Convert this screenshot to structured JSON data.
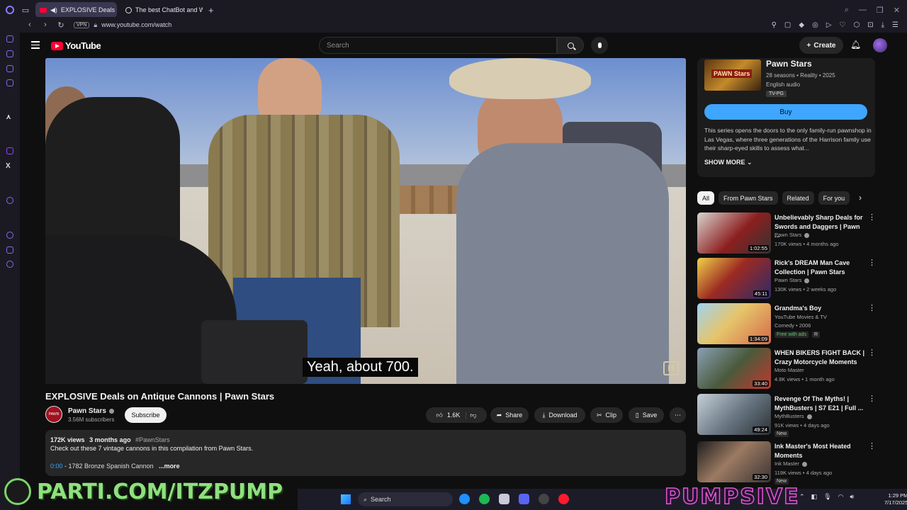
{
  "browser": {
    "tabs": [
      {
        "title": "EXPLOSIVE Deals on A",
        "active": true
      },
      {
        "title": "The best ChatBot and W",
        "active": false
      }
    ],
    "vpn_label": "VPN",
    "url": "www.youtube.com/watch"
  },
  "youtube": {
    "logo_text": "YouTube",
    "search_placeholder": "Search",
    "create_label": "Create"
  },
  "player": {
    "caption": "Yeah, about 700.",
    "watermark": "H"
  },
  "video": {
    "title": "EXPLOSIVE Deals on Antique Cannons | Pawn Stars",
    "channel_name": "Pawn Stars",
    "channel_avatar_text": "PAWN",
    "subscribers": "3.56M subscribers",
    "subscribe_label": "Subscribe",
    "likes": "1.6K",
    "share_label": "Share",
    "download_label": "Download",
    "clip_label": "Clip",
    "save_label": "Save",
    "views": "172K views",
    "age": "3 months ago",
    "hashtag": "#PawnStars",
    "description": "Check out these 7 vintage cannons in this compilation from Pawn Stars.",
    "chapter_time": "0:00",
    "chapter_text": " - 1782 Bronze Spanish Cannon",
    "more_label": "...more"
  },
  "show_panel": {
    "title": "Pawn Stars",
    "thumb_text": "PAWN Stars",
    "meta1": "28 seasons • Reality • 2025",
    "meta2": "English audio",
    "rating": "TV-PG",
    "buy_label": "Buy",
    "description": "This series opens the doors to the only family-run pawnshop in Las Vegas, where three generations of the Harrison family use their sharp-eyed skills to assess what...",
    "show_more": "SHOW MORE"
  },
  "chips": [
    "All",
    "From Pawn Stars",
    "Related",
    "For you"
  ],
  "recommendations": [
    {
      "title": "Unbelievably Sharp Deals for Swords and Daggers | Pawn ...",
      "channel": "Pawn Stars",
      "meta": "170K views • 4 months ago",
      "duration": "1:02:55",
      "badge": "",
      "thumb": "#8c1f1f"
    },
    {
      "title": "Rick's DREAM Man Cave Collection | Pawn Stars",
      "channel": "Pawn Stars",
      "meta": "130K views • 2 weeks ago",
      "duration": "45:11",
      "badge": "",
      "thumb": "#9c2a22"
    },
    {
      "title": "Grandma's Boy",
      "channel": "YouTube Movies & TV",
      "meta": "Comedy • 2006",
      "duration": "1:34:09",
      "badge": "Free with ads",
      "badge2": "R",
      "thumb": "#7fb8d8"
    },
    {
      "title": "WHEN BIKERS FIGHT BACK | Crazy Motorcycle Moments",
      "channel": "Moto Master",
      "meta": "4.8K views • 1 month ago",
      "duration": "33:40",
      "badge": "",
      "thumb": "#4a5a3c"
    },
    {
      "title": "Revenge Of The Myths! | MythBusters | S7 E21 | Full ...",
      "channel": "MythBusters",
      "meta": "91K views • 4 days ago",
      "duration": "49:24",
      "badge": "New",
      "thumb": "#6b7a86"
    },
    {
      "title": "Ink Master's Most Heated Moments",
      "channel": "Ink Master",
      "meta": "119K views • 4 days ago",
      "duration": "32:30",
      "badge": "New",
      "thumb": "#3a3434"
    }
  ],
  "overlay": {
    "streamer_link": "PARTI.COM/ITZPUMP",
    "brand": "PUMPSIVE"
  },
  "taskbar": {
    "search_label": "Search",
    "time": "1:29 PM",
    "date": "7/17/2025"
  }
}
